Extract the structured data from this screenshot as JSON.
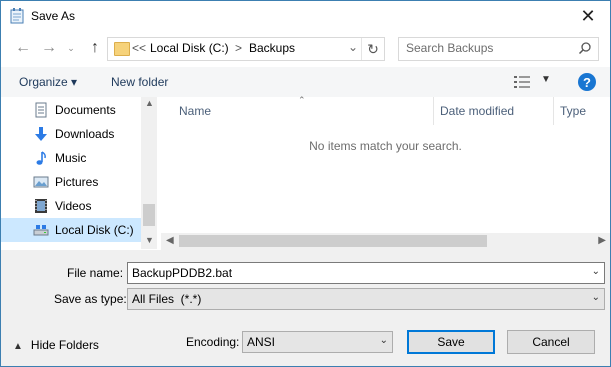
{
  "window": {
    "title": "Save As",
    "close_glyph": "✕"
  },
  "address": {
    "overflow": "<<",
    "crumbs": [
      "Local Disk (C:)",
      "Backups"
    ],
    "separator": ">"
  },
  "search": {
    "placeholder": "Search Backups"
  },
  "toolbar": {
    "organize_label": "Organize ▾",
    "new_folder_label": "New folder",
    "help_label": "?"
  },
  "sidebar": {
    "items": [
      {
        "label": "Documents",
        "icon": "documents-icon"
      },
      {
        "label": "Downloads",
        "icon": "downloads-icon"
      },
      {
        "label": "Music",
        "icon": "music-icon"
      },
      {
        "label": "Pictures",
        "icon": "pictures-icon"
      },
      {
        "label": "Videos",
        "icon": "videos-icon"
      },
      {
        "label": "Local Disk (C:)",
        "icon": "drive-icon",
        "selected": true
      }
    ]
  },
  "filelist": {
    "columns": [
      "Name",
      "Date modified",
      "Type"
    ],
    "empty_message": "No items match your search."
  },
  "form": {
    "file_name_label": "File name:",
    "file_name_value": "BackupPDDB2.bat",
    "save_as_type_label": "Save as type:",
    "save_as_type_value": "All Files  (*.*)",
    "encoding_label": "Encoding:",
    "encoding_value": "ANSI",
    "save_label": "Save",
    "cancel_label": "Cancel",
    "hide_folders_label": "Hide Folders"
  },
  "colors": {
    "accent": "#0078d7",
    "selected_bg": "#cce8ff",
    "toolbar_text": "#1e395b",
    "help_bg": "#1976d2"
  }
}
